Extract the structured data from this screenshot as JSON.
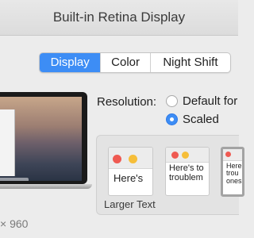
{
  "window": {
    "title": "Built-in Retina Display"
  },
  "tabs": [
    {
      "label": "Display",
      "active": true
    },
    {
      "label": "Color",
      "active": false
    },
    {
      "label": "Night Shift",
      "active": false
    }
  ],
  "preview": {
    "resolution_caption": "× 960"
  },
  "resolution": {
    "label": "Resolution:",
    "options": [
      {
        "label": "Default for",
        "selected": false
      },
      {
        "label": "Scaled",
        "selected": true
      }
    ]
  },
  "scaled": {
    "thumbnails": [
      {
        "text": "Here's"
      },
      {
        "text": "Here's to troublem"
      },
      {
        "text": "Here's trou ones"
      }
    ],
    "caption": "Larger Text"
  },
  "colors": {
    "accent": "#3d8df5",
    "close": "#ef5a52",
    "minimize": "#f6be39"
  }
}
